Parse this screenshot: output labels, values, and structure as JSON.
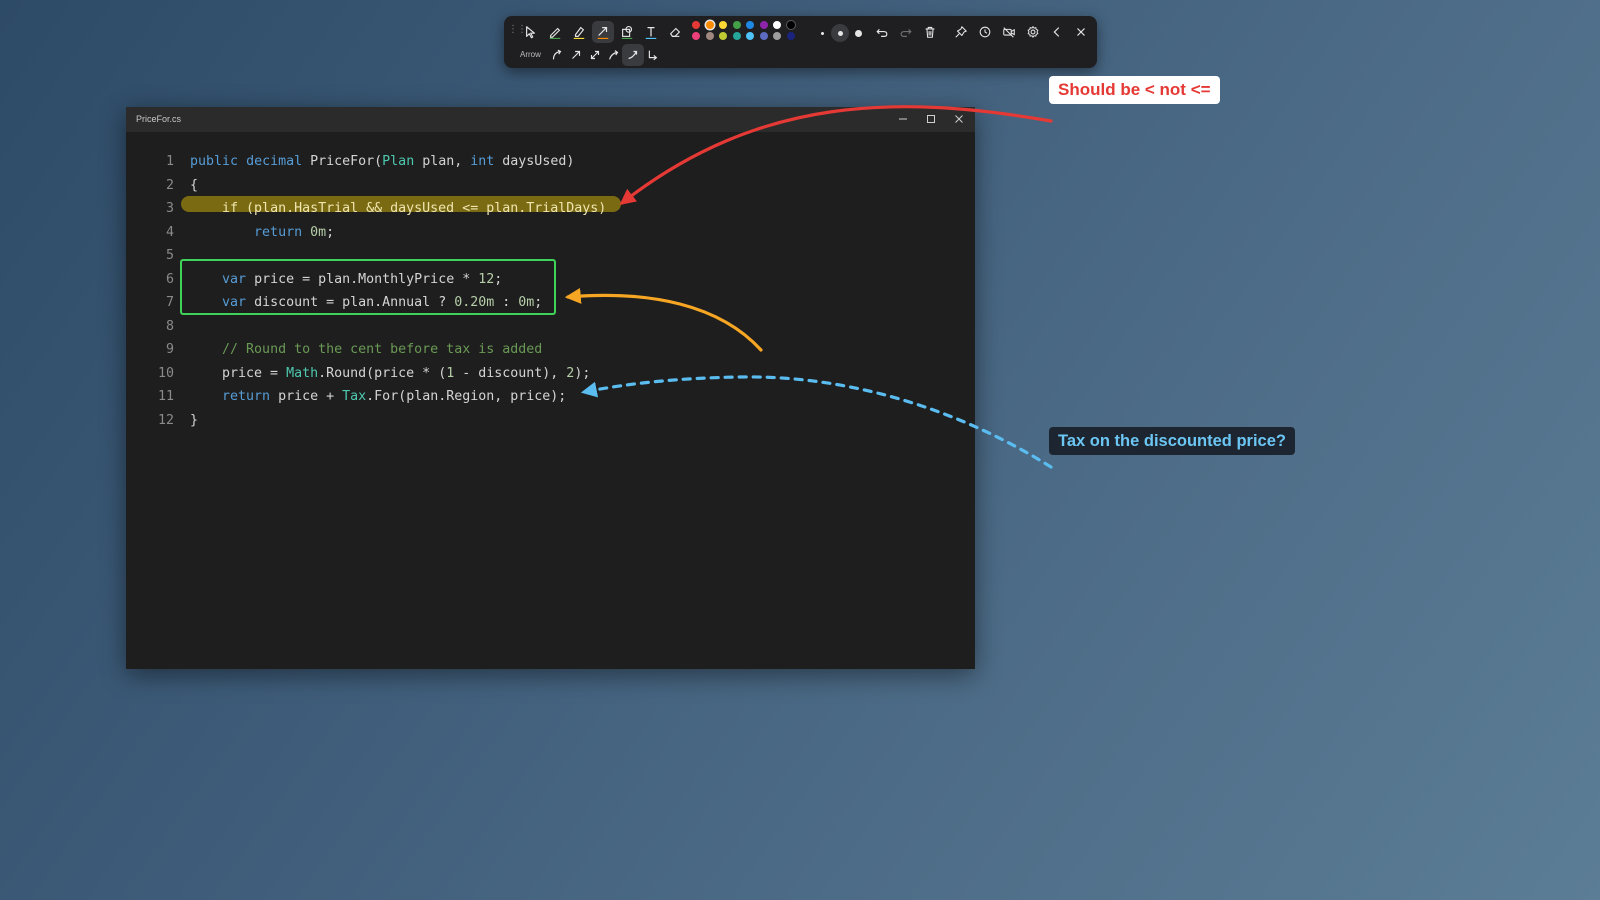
{
  "toolbar": {
    "mode_label": "Arrow",
    "tools": [
      {
        "icon": "cursor-icon"
      },
      {
        "icon": "pen-icon"
      },
      {
        "icon": "highlighter-icon"
      },
      {
        "icon": "arrow-tool-icon",
        "active": true
      },
      {
        "icon": "shape-icon"
      },
      {
        "icon": "text-icon"
      },
      {
        "icon": "eraser-icon"
      }
    ],
    "colors": [
      "#e53935",
      "#fb8c00",
      "#fdd835",
      "#43a047",
      "#1e88e5",
      "#8e24aa",
      "#ffffff",
      "#000000",
      "#ec407a",
      "#a1887f",
      "#c0ca33",
      "#26a69a",
      "#4fc3f7",
      "#5c6bc0",
      "#9e9e9e",
      "#1a237e"
    ],
    "active_color": "#fb8c00",
    "stroke_sizes": [
      "small",
      "medium",
      "large"
    ],
    "active_stroke": "medium",
    "actions": [
      {
        "icon": "undo-icon"
      },
      {
        "icon": "redo-icon"
      },
      {
        "icon": "trash-icon"
      },
      {
        "icon": "pin-icon"
      },
      {
        "icon": "clock-icon"
      },
      {
        "icon": "video-off-icon"
      },
      {
        "icon": "gear-icon"
      },
      {
        "icon": "chevron-left-icon"
      },
      {
        "icon": "close-icon"
      }
    ],
    "arrow_styles": [
      {
        "icon": "arrow-curved-icon"
      },
      {
        "icon": "arrow-straight-icon"
      },
      {
        "icon": "arrow-double-icon"
      },
      {
        "icon": "arrow-curve-up-icon"
      },
      {
        "icon": "arrow-swoosh-icon",
        "active": true
      },
      {
        "icon": "arrow-elbow-icon"
      }
    ]
  },
  "window": {
    "title": "PriceFor.cs",
    "controls": {
      "minimize": "minimize-icon",
      "maximize": "maximize-icon",
      "close": "close-icon"
    }
  },
  "code": {
    "line_numbers": [
      "1",
      "2",
      "3",
      "4",
      "5",
      "6",
      "7",
      "8",
      "9",
      "10",
      "11",
      "12"
    ],
    "lines": [
      [
        [
          "kw",
          "public"
        ],
        [
          "",
          ""
        ],
        [
          "",
          " "
        ],
        [
          "kw",
          "decimal"
        ],
        [
          "",
          " PriceFor("
        ],
        [
          "ty",
          "Plan"
        ],
        [
          "",
          " plan, "
        ],
        [
          "kw",
          "int"
        ],
        [
          "",
          " daysUsed)"
        ]
      ],
      [
        [
          "",
          "{"
        ]
      ],
      [
        [
          "",
          "    "
        ],
        [
          "",
          "if (plan.HasTrial && daysUsed <= plan.TrialDays)"
        ]
      ],
      [
        [
          "",
          "        "
        ],
        [
          "kw",
          "return"
        ],
        [
          "",
          " "
        ],
        [
          "nm",
          "0m"
        ],
        [
          "",
          ";"
        ]
      ],
      [],
      [
        [
          "",
          "    "
        ],
        [
          "kw",
          "var"
        ],
        [
          "",
          " price = plan.MonthlyPrice * "
        ],
        [
          "nm",
          "12"
        ],
        [
          "",
          ";"
        ]
      ],
      [
        [
          "",
          "    "
        ],
        [
          "kw",
          "var"
        ],
        [
          "",
          " discount = plan.Annual ? "
        ],
        [
          "nm",
          "0.20m"
        ],
        [
          "",
          " : "
        ],
        [
          "nm",
          "0m"
        ],
        [
          "",
          ";"
        ]
      ],
      [],
      [
        [
          "",
          "    "
        ],
        [
          "cm",
          "// Round to the cent before tax is added"
        ]
      ],
      [
        [
          "",
          "    price = "
        ],
        [
          "ty",
          "Math"
        ],
        [
          "",
          ".Round(price * ("
        ],
        [
          "nm",
          "1"
        ],
        [
          "",
          " - discount), "
        ],
        [
          "nm",
          "2"
        ],
        [
          "",
          ");"
        ]
      ],
      [
        [
          "",
          "    "
        ],
        [
          "kw",
          "return"
        ],
        [
          "",
          " price + "
        ],
        [
          "ty",
          "Tax"
        ],
        [
          "",
          ".For(plan.Region, price);"
        ]
      ],
      [
        [
          "",
          "}"
        ]
      ]
    ]
  },
  "annotations": {
    "callout_red": "Should be < not <=",
    "callout_blue": "Tax on the discounted price?",
    "colors": {
      "red": "#e53935",
      "orange": "#f6a623",
      "green": "#3fd35a",
      "blue": "#5bbcf0",
      "highlight": "#7a6a12"
    }
  }
}
